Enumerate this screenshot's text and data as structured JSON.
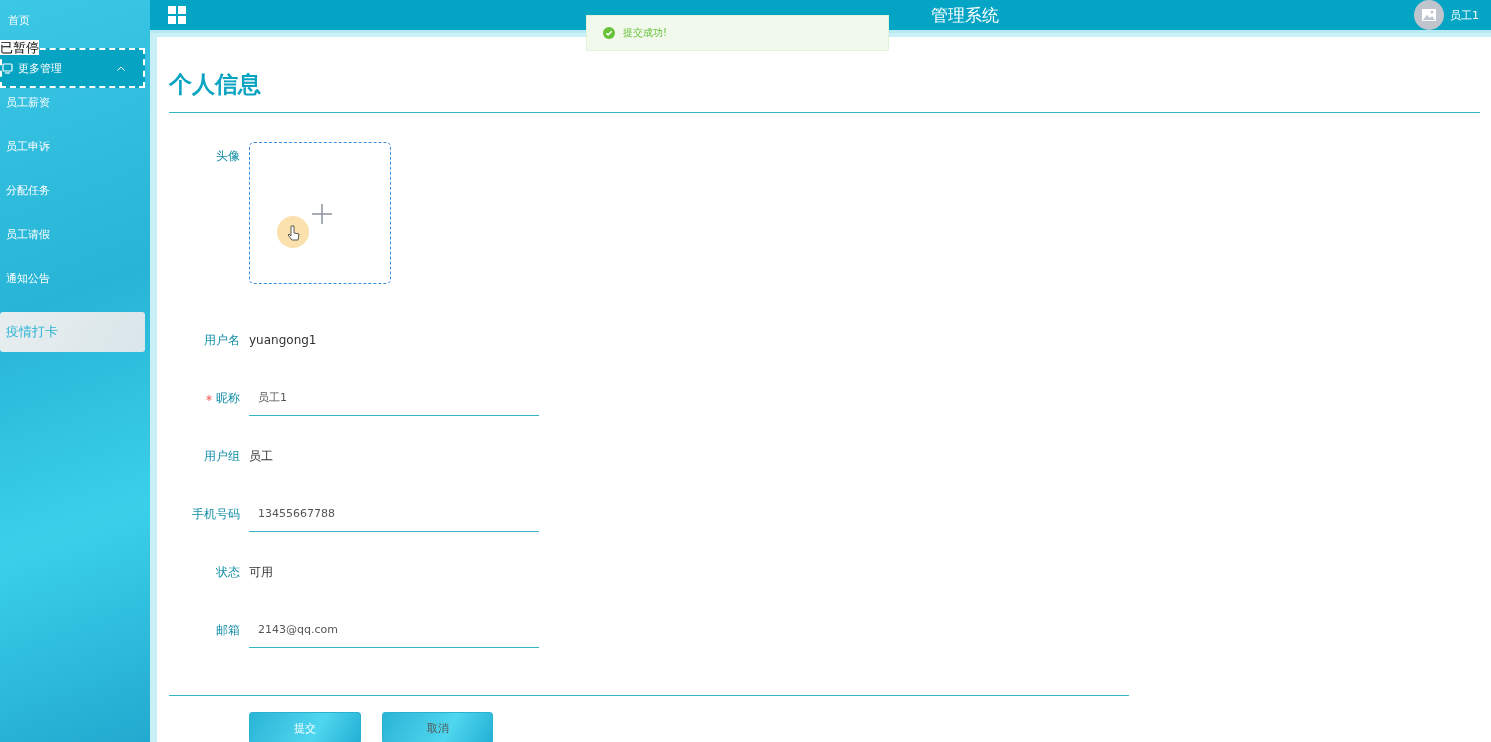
{
  "header": {
    "title": "管理系统",
    "user": "员工1"
  },
  "toast": {
    "message": "提交成功!"
  },
  "paused_label": "已暂停",
  "sidebar": {
    "items": [
      {
        "label": "首页",
        "kind": "link"
      },
      {
        "label": "更多管理",
        "kind": "group",
        "expanded": true,
        "children": [
          {
            "label": "员工薪资"
          },
          {
            "label": "员工申诉"
          },
          {
            "label": "分配任务"
          },
          {
            "label": "员工请假"
          },
          {
            "label": "通知公告"
          }
        ]
      },
      {
        "label": "疫情打卡",
        "kind": "card"
      }
    ]
  },
  "page": {
    "title": "个人信息"
  },
  "form": {
    "fields": [
      {
        "label": "头像",
        "kind": "upload",
        "required": false
      },
      {
        "label": "用户名",
        "kind": "text",
        "value": "yuangong1",
        "required": false
      },
      {
        "label": "昵称",
        "kind": "input",
        "value": "员工1",
        "required": true
      },
      {
        "label": "用户组",
        "kind": "text",
        "value": "员工",
        "required": false
      },
      {
        "label": "手机号码",
        "kind": "input",
        "value": "13455667788",
        "required": false
      },
      {
        "label": "状态",
        "kind": "text",
        "value": "可用",
        "required": false
      },
      {
        "label": "邮箱",
        "kind": "input",
        "value": "2143@qq.com",
        "required": false
      }
    ]
  },
  "buttons": [
    {
      "label": "提交"
    },
    {
      "label": "取消"
    }
  ]
}
